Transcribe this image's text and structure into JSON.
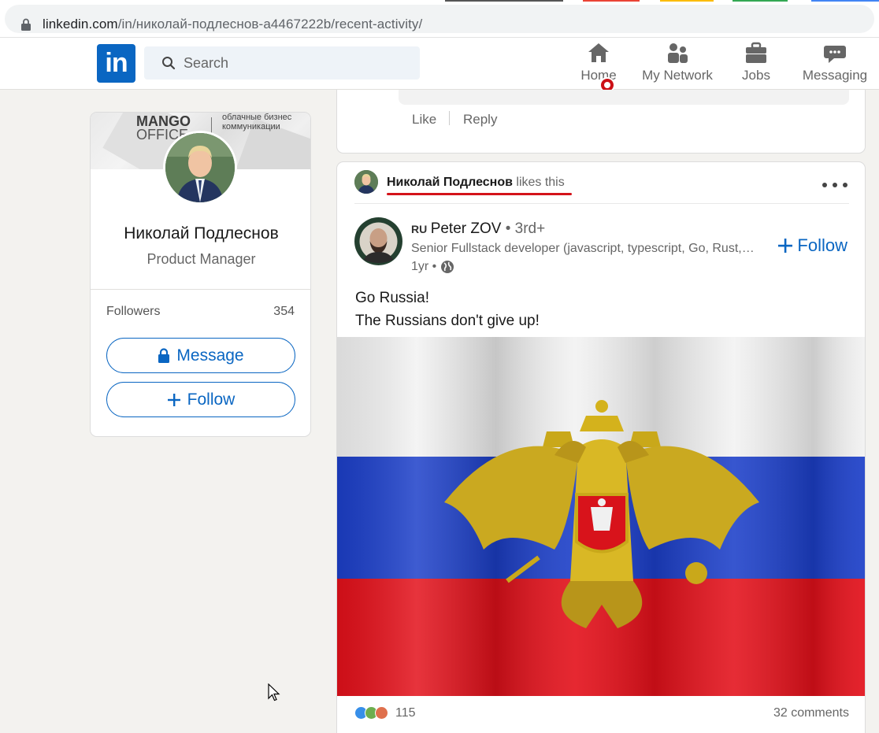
{
  "browser": {
    "url_domain": "linkedin.com",
    "url_path": "/in/николай-подлеснов-a4467222b/recent-activity/"
  },
  "header": {
    "logo": "in",
    "search_placeholder": "Search",
    "nav": [
      {
        "label": "Home",
        "icon": "home-icon"
      },
      {
        "label": "My Network",
        "icon": "network-icon"
      },
      {
        "label": "Jobs",
        "icon": "jobs-icon"
      },
      {
        "label": "Messaging",
        "icon": "messaging-icon"
      }
    ]
  },
  "profile": {
    "cover_brand": "MANGO",
    "cover_brand_2": "OFFICE",
    "cover_tagline": "облачные бизнес коммуникации",
    "name": "Николай Подлеснов",
    "title": "Product Manager",
    "followers_label": "Followers",
    "followers_count": "354",
    "message_label": "Message",
    "follow_label": "Follow"
  },
  "previous_post": {
    "like_label": "Like",
    "reply_label": "Reply"
  },
  "activity": {
    "liker_name": "Николай Подлеснов",
    "liker_suffix": " likes this",
    "author": {
      "country": "RU",
      "name": "Peter ZOV",
      "degree": " • 3rd+",
      "headline": "Senior Fullstack developer (javascript, typescript, Go, Rust, Python)",
      "time": "1yr •"
    },
    "follow_label": "Follow",
    "text_line_1": "Go Russia!",
    "text_line_2": "The Russians don't give up!",
    "reaction_count": "115",
    "comments_count": "32 comments"
  },
  "colors": {
    "linkedin_blue": "#0a66c2",
    "flag_white": "#f2f2f2",
    "flag_blue": "#1c3fc9",
    "flag_red": "#e3101a",
    "notification_red": "#cc1016"
  }
}
